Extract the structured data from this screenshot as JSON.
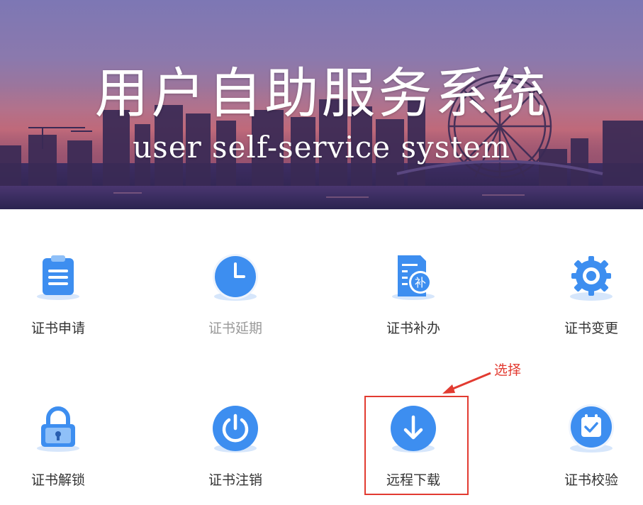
{
  "banner": {
    "title": "用户自助服务系统",
    "subtitle": "user self-service system"
  },
  "tiles": [
    {
      "label": "证书申请",
      "icon": "clipboard-list-icon",
      "enabled": true
    },
    {
      "label": "证书延期",
      "icon": "clock-icon",
      "enabled": false
    },
    {
      "label": "证书补办",
      "icon": "document-reissue-icon",
      "enabled": true
    },
    {
      "label": "证书变更",
      "icon": "gear-icon",
      "enabled": true
    },
    {
      "label": "证书解锁",
      "icon": "padlock-icon",
      "enabled": true
    },
    {
      "label": "证书注销",
      "icon": "power-icon",
      "enabled": true
    },
    {
      "label": "远程下载",
      "icon": "download-arrow-icon",
      "enabled": true
    },
    {
      "label": "证书校验",
      "icon": "calendar-check-icon",
      "enabled": true
    }
  ],
  "annotation": {
    "text": "选择",
    "color": "#e23b31"
  },
  "colors": {
    "icon_blue": "#3d8ef0",
    "icon_blue_dark": "#2f6fd6"
  },
  "reissue_badge": "补"
}
